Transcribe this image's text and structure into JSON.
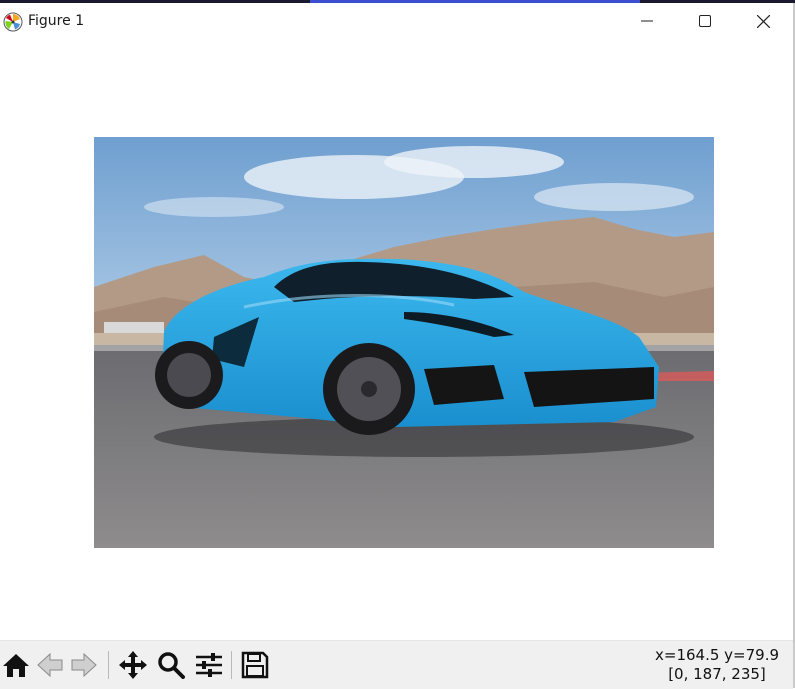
{
  "window": {
    "title": "Figure 1",
    "app_icon": "matplotlib-icon",
    "controls": {
      "minimize_icon": "minimize-icon",
      "maximize_icon": "maximize-icon",
      "close_icon": "close-icon"
    }
  },
  "figure": {
    "image_alt": "blue sports car on track with mountains",
    "colors": {
      "sky": "#8ab6de",
      "car": "#2aa7e3",
      "road": "#6f6f72",
      "mountains": "#a89080"
    }
  },
  "toolbar": {
    "buttons": [
      {
        "name": "home",
        "icon": "home-icon"
      },
      {
        "name": "back",
        "icon": "arrow-left-icon"
      },
      {
        "name": "forward",
        "icon": "arrow-right-icon"
      },
      {
        "name": "pan",
        "icon": "move-icon"
      },
      {
        "name": "zoom",
        "icon": "zoom-icon"
      },
      {
        "name": "configure-subplots",
        "icon": "sliders-icon"
      },
      {
        "name": "save",
        "icon": "save-icon"
      }
    ],
    "status": {
      "xy": "x=164.5 y=79.9",
      "rgb": "[0, 187, 235]"
    }
  }
}
